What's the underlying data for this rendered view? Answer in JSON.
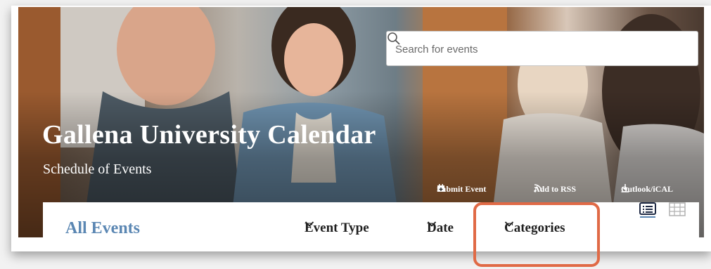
{
  "search": {
    "placeholder": "Search for events"
  },
  "header": {
    "title": "Gallena University Calendar",
    "subtitle": "Schedule of Events"
  },
  "actions": [
    {
      "label": "Submit Event",
      "icon": "calendar-plus-icon"
    },
    {
      "label": "Add to RSS",
      "icon": "rss-icon"
    },
    {
      "label": "Outlook/iCAL",
      "icon": "download-icon"
    }
  ],
  "toolbar": {
    "heading": "All Events",
    "filters": [
      {
        "label": "Event Type",
        "icon": "chevron-down-icon"
      },
      {
        "label": "Date",
        "icon": "chevron-down-icon"
      },
      {
        "label": "Categories",
        "icon": "chevron-down-icon"
      }
    ],
    "views": [
      {
        "name": "list-view",
        "icon": "list-view-icon",
        "active": true
      },
      {
        "name": "grid-view",
        "icon": "grid-view-icon",
        "active": false
      }
    ]
  },
  "colors": {
    "accent": "#5b87b3",
    "highlight": "#e06a46",
    "text": "#1f1f1f"
  }
}
